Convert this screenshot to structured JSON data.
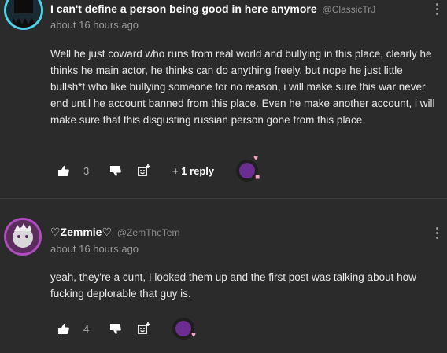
{
  "comments": [
    {
      "username": "I can't define a person being good in here anymore",
      "handle": "@ClassicTrJ",
      "timestamp": "about 16 hours ago",
      "body": "Well he just coward who runs from real world and bullying in this place, clearly he thinks he main actor, he thinks can do anything freely. but nope he just little bullsh*t who like bullying someone for no reason, i will make sure this war never end until he account banned from this place. Even he make another account, i will make sure that this disgusting russian person gone from this place",
      "like_count": "3",
      "reply_label": "+ 1 reply"
    },
    {
      "username": "♡Zemmie♡",
      "handle": "@ZemTheTem",
      "timestamp": "about 16 hours ago",
      "body": "yeah, they're a cunt, I looked them up and the first post was talking about how fucking deplorable that guy is.",
      "like_count": "4"
    }
  ],
  "icons": {
    "like": "thumbs-up-icon",
    "dislike": "thumbs-down-icon",
    "reply": "reply-icon",
    "menu": "more-vertical-icon"
  },
  "colors": {
    "background": "#2b2b2b",
    "text": "#e8e8e8",
    "muted": "#9a9a9a",
    "avatar_ring_1": "#4fd1e8",
    "avatar_ring_2": "#b04cc0"
  }
}
